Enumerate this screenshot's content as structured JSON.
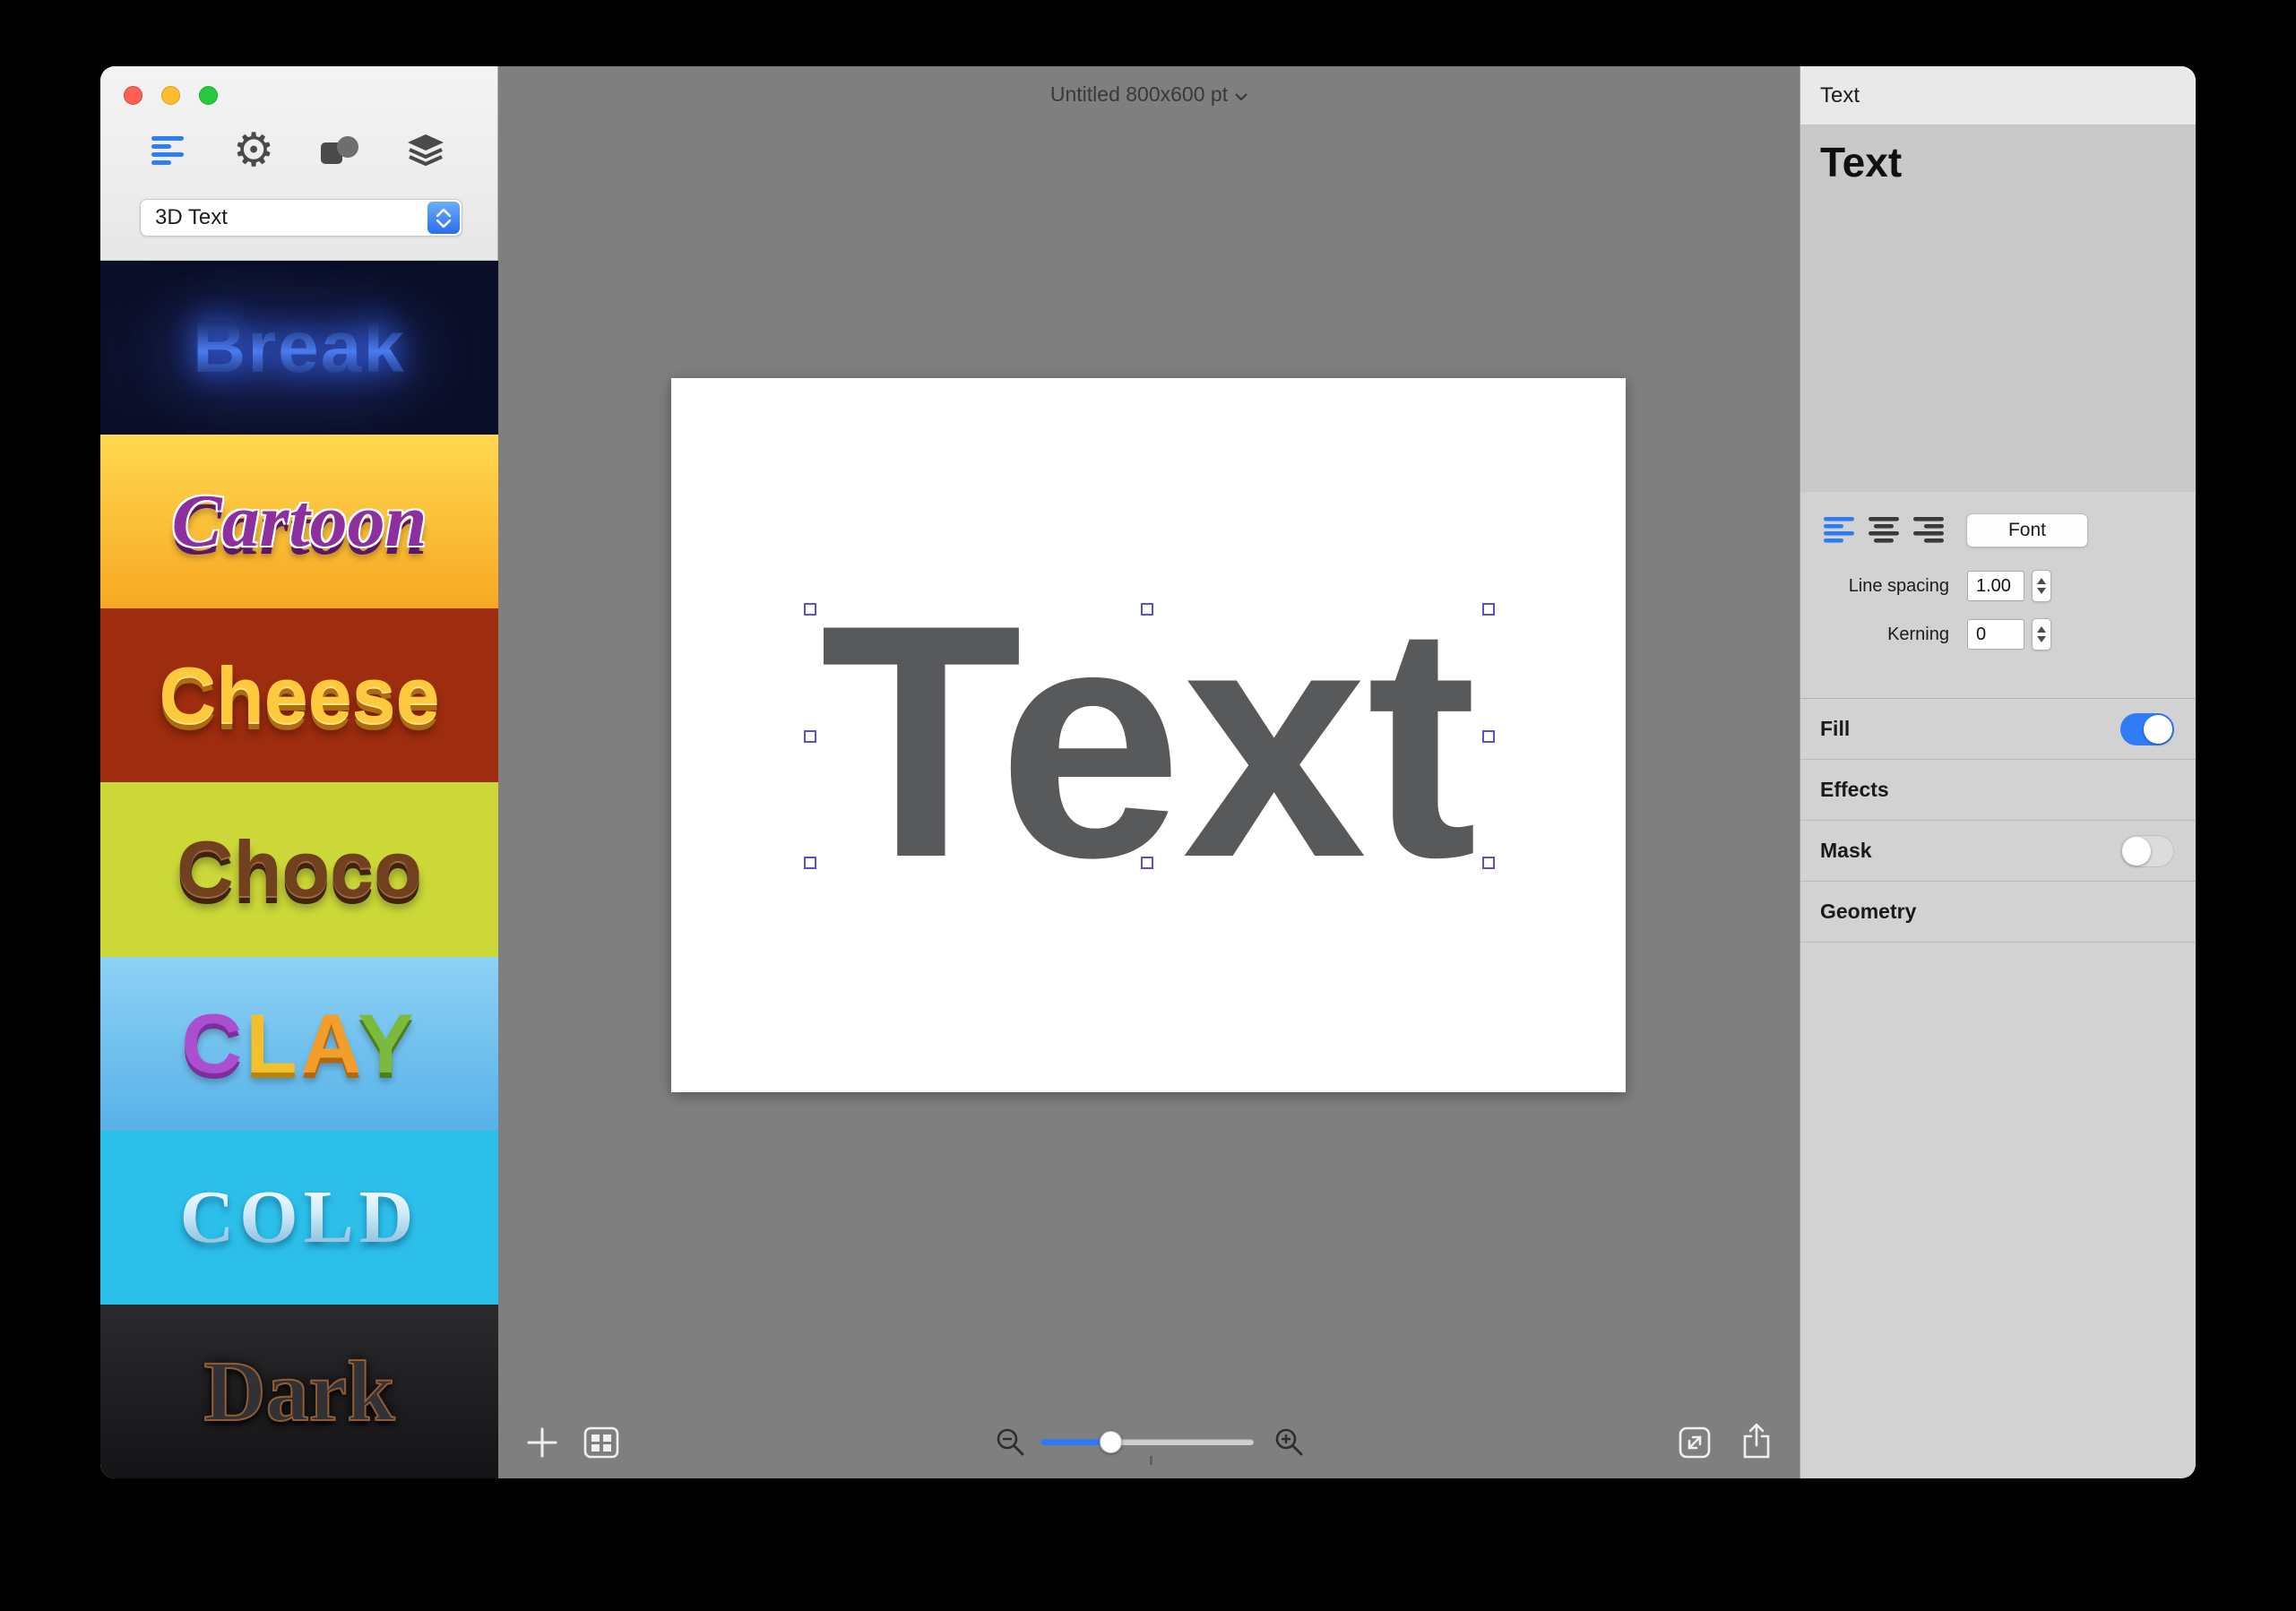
{
  "window": {
    "title": "Untitled 800x600 pt",
    "traffic_lights": [
      "close",
      "minimize",
      "fullscreen"
    ]
  },
  "sidebar": {
    "toolbar_icons": [
      "templates-list-icon",
      "settings-gear-icon",
      "shapes-icon",
      "layers-icon"
    ],
    "style_dropdown": {
      "value": "3D Text"
    },
    "templates": [
      {
        "name": "Break",
        "bg": "#0a0e26",
        "text_color": "#4a7bf0"
      },
      {
        "name": "Cartoon",
        "bg": "#ffc63c",
        "text_color": "#8e2f9e"
      },
      {
        "name": "Cheese",
        "bg": "#9e2c0e",
        "text_color": "#ffc93e"
      },
      {
        "name": "Choco",
        "bg": "#cbd838",
        "text_color": "#70401f"
      },
      {
        "name": "CLAY",
        "bg": "#6fc1ef",
        "letters": [
          {
            "ch": "C",
            "color": "#ab4fd1"
          },
          {
            "ch": "L",
            "color": "#f3c02d"
          },
          {
            "ch": "A",
            "color": "#f29e2b"
          },
          {
            "ch": "Y",
            "color": "#7cba3e"
          }
        ]
      },
      {
        "name": "COLD",
        "bg": "#2cbfe9",
        "text_color": "#dff1fc"
      },
      {
        "name": "Dark",
        "bg": "#1c1c1e",
        "text_color": "#3a3a3e"
      }
    ]
  },
  "canvas": {
    "artboard_text": "Text",
    "tool_icons": [
      "add-icon",
      "pages-grid-icon",
      "zoom-out-icon",
      "zoom-slider",
      "zoom-in-icon",
      "scale-icon",
      "share-icon"
    ]
  },
  "inspector": {
    "tab_title": "Text",
    "content_text": "Text",
    "font_button_label": "Font",
    "align_icons": [
      "align-left-icon",
      "align-center-icon",
      "align-right-icon"
    ],
    "line_spacing": {
      "label": "Line spacing",
      "value": "1.00"
    },
    "kerning": {
      "label": "Kerning",
      "value": "0"
    },
    "sections": {
      "fill": {
        "label": "Fill",
        "toggle": "on"
      },
      "effects": {
        "label": "Effects"
      },
      "mask": {
        "label": "Mask",
        "toggle": "off"
      },
      "geometry": {
        "label": "Geometry"
      }
    }
  },
  "colors": {
    "accent_blue": "#2e7cf6",
    "canvas_background": "#7f7f7f",
    "selection_handle_border": "#5a51ce"
  }
}
